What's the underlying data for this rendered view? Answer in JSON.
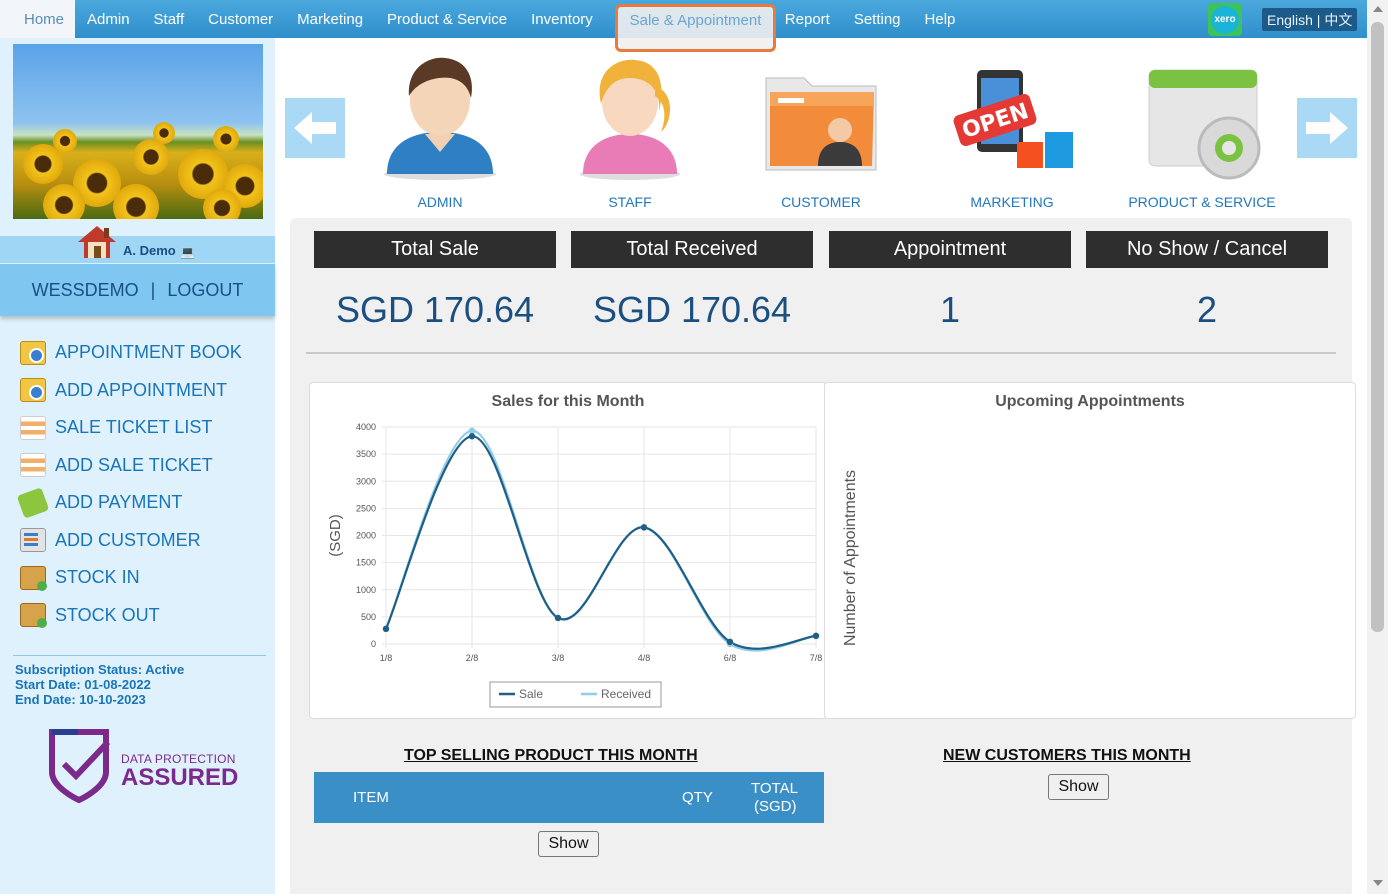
{
  "nav": {
    "items": [
      "Home",
      "Admin",
      "Staff",
      "Customer",
      "Marketing",
      "Product & Service",
      "Inventory",
      "Sale & Appointment",
      "Report",
      "Setting",
      "Help"
    ],
    "xero": "xero",
    "language": "English | 中文"
  },
  "sidebar": {
    "user_name": "A. Demo",
    "account": "WESSDEMO",
    "separator": "|",
    "logout": "LOGOUT",
    "menu": [
      "APPOINTMENT BOOK",
      "ADD APPOINTMENT",
      "SALE TICKET LIST",
      "ADD SALE TICKET",
      "ADD PAYMENT",
      "ADD CUSTOMER",
      "STOCK IN",
      "STOCK OUT"
    ],
    "subscription_status": "Subscription Status: Active",
    "start_date": "Start Date: 01-08-2022",
    "end_date": "End Date: 10-10-2023",
    "dp_line1": "DATA PROTECTION",
    "dp_line2": "ASSURED"
  },
  "quick_links": [
    "ADMIN",
    "STAFF",
    "CUSTOMER",
    "MARKETING",
    "PRODUCT & SERVICE"
  ],
  "stats": {
    "headers": [
      "Total Sale",
      "Total Received",
      "Appointment",
      "No Show / Cancel"
    ],
    "values": [
      "SGD 170.64",
      "SGD 170.64",
      "1",
      "2"
    ]
  },
  "sales_chart_title": "Sales for this Month",
  "appointments_chart_title": "Upcoming Appointments",
  "appointments_ylabel": "Number of Appointments",
  "chart_data": {
    "type": "line",
    "title": "Sales for this Month",
    "xlabel": "",
    "ylabel": "(SGD)",
    "categories": [
      "1/8",
      "2/8",
      "3/8",
      "4/8",
      "6/8",
      "7/8"
    ],
    "yticks": [
      0,
      500,
      1000,
      1500,
      2000,
      2500,
      3000,
      3500,
      4000
    ],
    "ylim": [
      0,
      4000
    ],
    "series": [
      {
        "name": "Sale",
        "color": "#1f5f86",
        "values": [
          280,
          3830,
          480,
          2150,
          40,
          150
        ]
      },
      {
        "name": "Received",
        "color": "#8fcde8",
        "values": [
          280,
          3930,
          480,
          2150,
          0,
          150
        ]
      }
    ],
    "legend": "bottom",
    "grid": true
  },
  "top_selling": {
    "title": "TOP SELLING PRODUCT THIS MONTH",
    "col_item": "ITEM",
    "col_qty": "QTY",
    "col_total_1": "TOTAL",
    "col_total_2": "(SGD)",
    "show": "Show"
  },
  "new_customers": {
    "title": "NEW CUSTOMERS THIS MONTH",
    "show": "Show"
  }
}
